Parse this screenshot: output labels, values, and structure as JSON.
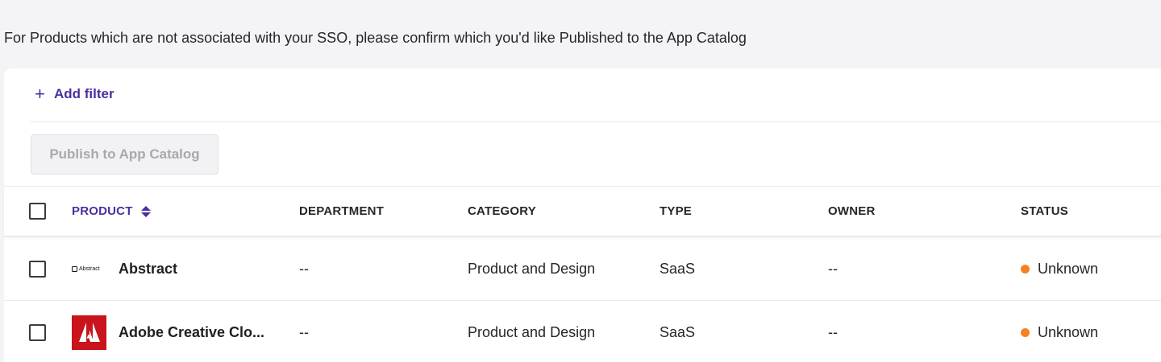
{
  "intro_text": "For Products which are not associated with your SSO, please confirm which you'd like Published to the App Catalog",
  "filter": {
    "label": "Add filter"
  },
  "publish_button": {
    "label": "Publish to App Catalog"
  },
  "columns": [
    "PRODUCT",
    "DEPARTMENT",
    "CATEGORY",
    "TYPE",
    "OWNER",
    "STATUS"
  ],
  "rows": [
    {
      "logo": "abstract-logo",
      "logo_text": "Abstract",
      "product": "Abstract",
      "department": "--",
      "category": "Product and Design",
      "type": "SaaS",
      "owner": "--",
      "status": "Unknown"
    },
    {
      "logo": "adobe-logo",
      "product": "Adobe Creative Clo...",
      "department": "--",
      "category": "Product and Design",
      "type": "SaaS",
      "owner": "--",
      "status": "Unknown"
    }
  ],
  "colors": {
    "accent": "#4b2fa0",
    "status_unknown": "#f5821f",
    "adobe_red": "#c8141a"
  }
}
